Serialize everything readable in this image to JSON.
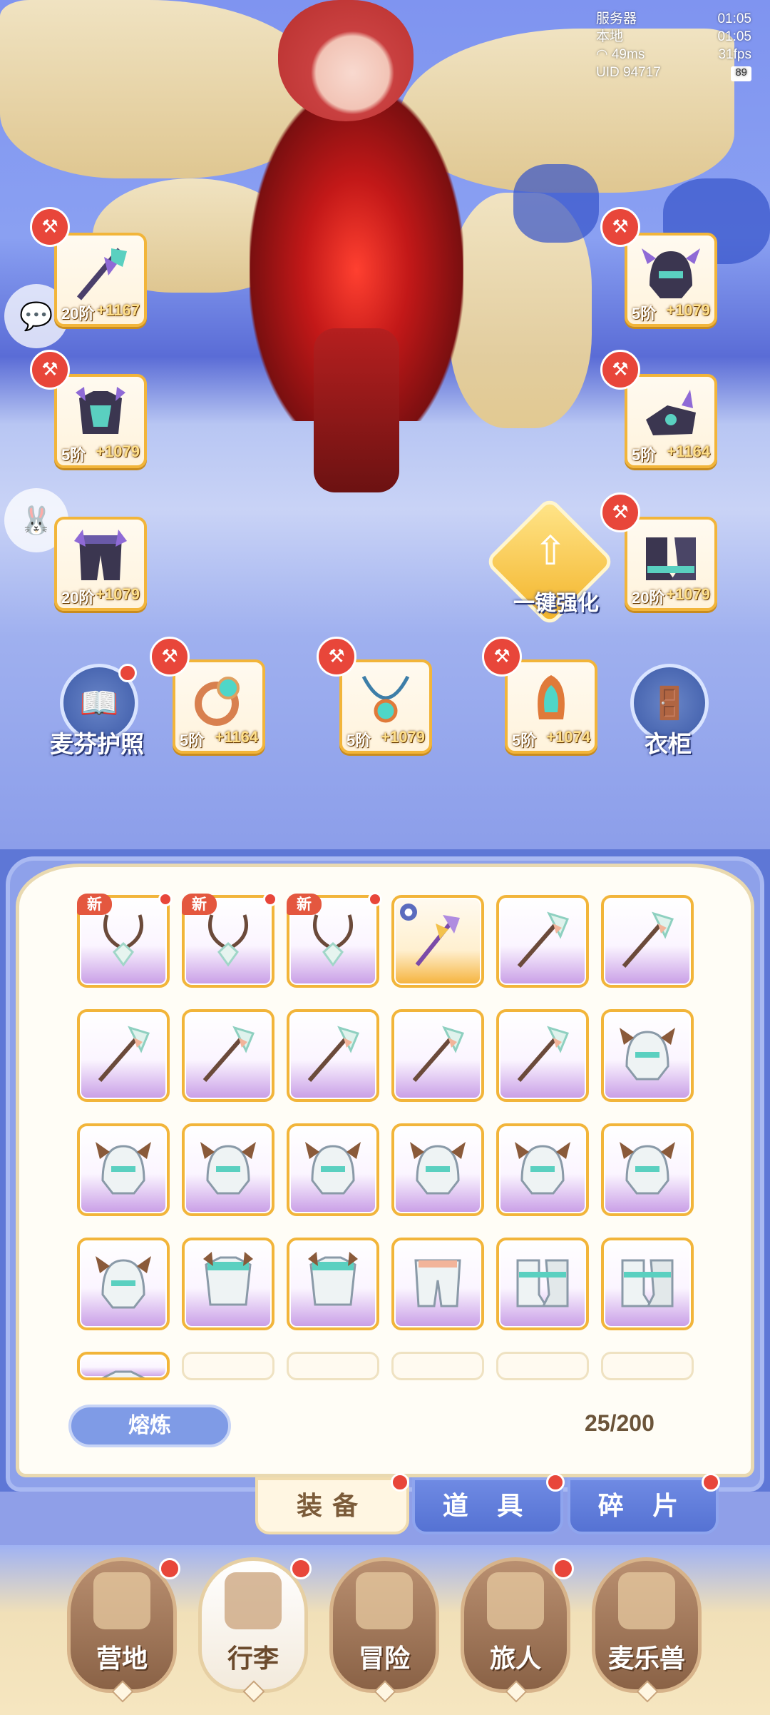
{
  "status": {
    "server_label": "服务器",
    "server_time": "01:05",
    "local_label": "本地",
    "local_time": "01:05",
    "ping": "49ms",
    "fps": "31fps",
    "uid": "UID 94717",
    "battery": "89"
  },
  "equipment": {
    "weapon": {
      "tier": "20阶",
      "level": "+1167"
    },
    "chest": {
      "tier": "5阶",
      "level": "+1079"
    },
    "pants": {
      "tier": "20阶",
      "level": "+1079"
    },
    "helmet": {
      "tier": "5阶",
      "level": "+1079"
    },
    "gloves": {
      "tier": "5阶",
      "level": "+1164"
    },
    "boots": {
      "tier": "20阶",
      "level": "+1079"
    },
    "ring": {
      "tier": "5阶",
      "level": "+1164"
    },
    "necklace": {
      "tier": "5阶",
      "level": "+1079"
    },
    "charm": {
      "tier": "5阶",
      "level": "+1074"
    }
  },
  "buttons": {
    "strengthen": "一键强化",
    "passport": "麦芬护照",
    "wardrobe": "衣柜",
    "smelt": "熔炼"
  },
  "inventory": {
    "new_tag": "新",
    "count": "25/200"
  },
  "tabs": [
    "装备",
    "道 具",
    "碎 片"
  ],
  "nav": [
    "营地",
    "行李",
    "冒险",
    "旅人",
    "麦乐兽"
  ],
  "colors": {
    "accent_gold": "#f2b53a",
    "badge_red": "#e8463a",
    "panel_blue": "#5e77d6"
  }
}
